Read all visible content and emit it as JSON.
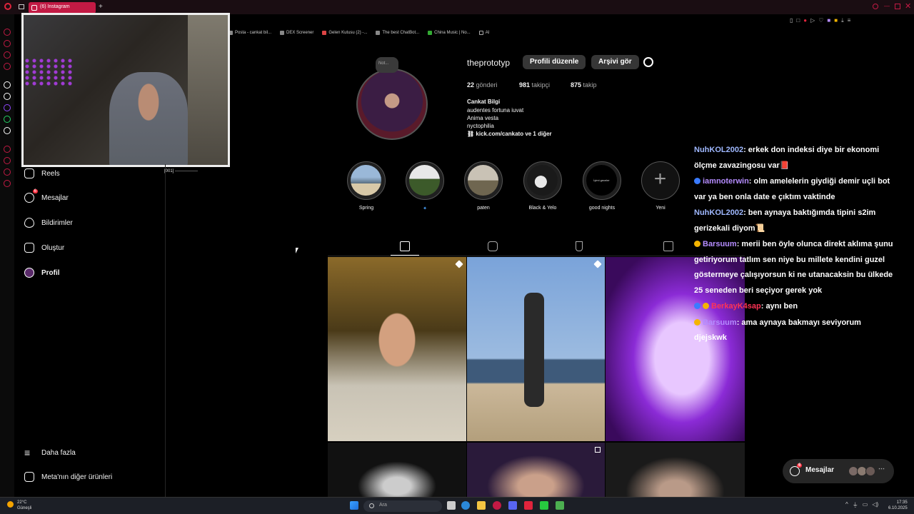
{
  "browser": {
    "tab_title": "(6) Instagram",
    "bookmarks": [
      "Posta - cankat bil...",
      "DEX Screener",
      "Gelen Kutusu (2) -...",
      "The best ChatBot...",
      "China Music | No...",
      "AI"
    ]
  },
  "webcam": {
    "label": "[001] ----------------"
  },
  "sidebar": {
    "items": [
      {
        "label": "Reels"
      },
      {
        "label": "Mesajlar",
        "badge": "6"
      },
      {
        "label": "Bildirimler"
      },
      {
        "label": "Oluştur"
      },
      {
        "label": "Profil"
      }
    ],
    "more": "Daha fazla",
    "meta": "Meta'nın diğer ürünleri"
  },
  "profile": {
    "note": "Not...",
    "username": "theprototyp",
    "edit_label": "Profili düzenle",
    "archive_label": "Arşivi gör",
    "posts_count": "22",
    "posts_label": "gönderi",
    "followers_count": "981",
    "followers_label": "takipçi",
    "following_count": "875",
    "following_label": "takip",
    "name": "Cankat Bilgi",
    "bio": [
      "audentes fortuna iuvat",
      "Anima vesta",
      "nyctophilia"
    ],
    "link": "kick.com/cankato ve 1 diğer"
  },
  "highlights": [
    {
      "label": "Spring"
    },
    {
      "label": "✦"
    },
    {
      "label": "paten"
    },
    {
      "label": "Black & Yelo"
    },
    {
      "label": "good nights",
      "cover_text": "İyimi geceler"
    },
    {
      "label": "Yeni"
    }
  ],
  "chat": {
    "messages": [
      {
        "user": "NuhKOL2002",
        "text": ": erkek don indeksi diye bir ekonomi ölçme zavazingosu var📕"
      },
      {
        "user": "iamnoterwin",
        "text": ": olm amelelerin giydiği demir uçli bot var ya ben onla date e çıktım vaktinde"
      },
      {
        "user": "NuhKOL2002",
        "text": ": ben aynaya baktığımda tipini s2im gerizekali diyom📜"
      },
      {
        "user": "Barsuum",
        "text": ": merii ben öyle olunca direkt aklıma şunu getiriyorum tatlım sen niye bu millete kendini guzel göstermeye çalışıyorsun ki ne utanacaksin bu ülkede 25 seneden beri seçiyor gerek yok"
      },
      {
        "user": "BerkayK4sap",
        "text": ": aynı ben"
      },
      {
        "user": "Barsuum",
        "text": ": ama aynaya bakmayı seviyorum djejskwk"
      }
    ]
  },
  "messages_pill": {
    "label": "Mesajlar",
    "badge": "6"
  },
  "taskbar": {
    "temp": "22°C",
    "weather": "Güneşli",
    "search_placeholder": "Ara",
    "time": "17:35",
    "date": "6.10.2025"
  }
}
